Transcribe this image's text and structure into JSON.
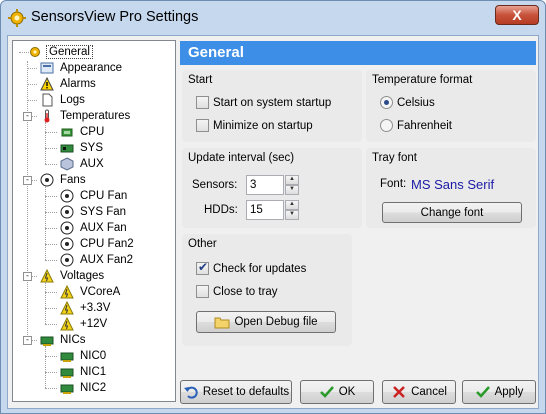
{
  "window": {
    "title": "SensorsView Pro Settings",
    "close_label": "X"
  },
  "tree": {
    "items": [
      {
        "label": "General",
        "icon": "gear-icon"
      },
      {
        "label": "Appearance",
        "icon": "appearance-icon"
      },
      {
        "label": "Alarms",
        "icon": "warning-icon"
      },
      {
        "label": "Logs",
        "icon": "document-icon"
      },
      {
        "label": "Temperatures",
        "icon": "thermometer-icon"
      },
      {
        "label": "CPU",
        "icon": "cpu-icon"
      },
      {
        "label": "SYS",
        "icon": "board-icon"
      },
      {
        "label": "AUX",
        "icon": "cube-icon"
      },
      {
        "label": "Fans",
        "icon": "fan-icon"
      },
      {
        "label": "CPU Fan",
        "icon": "fan-icon"
      },
      {
        "label": "SYS Fan",
        "icon": "fan-icon"
      },
      {
        "label": "AUX Fan",
        "icon": "fan-icon"
      },
      {
        "label": "CPU Fan2",
        "icon": "fan-icon"
      },
      {
        "label": "AUX Fan2",
        "icon": "fan-icon"
      },
      {
        "label": "Voltages",
        "icon": "voltage-icon"
      },
      {
        "label": "VCoreA",
        "icon": "voltage-icon"
      },
      {
        "label": "+3.3V",
        "icon": "voltage-icon"
      },
      {
        "label": "+12V",
        "icon": "voltage-icon"
      },
      {
        "label": "NICs",
        "icon": "nic-icon"
      },
      {
        "label": "NIC0",
        "icon": "nic-icon"
      },
      {
        "label": "NIC1",
        "icon": "nic-icon"
      },
      {
        "label": "NIC2",
        "icon": "nic-icon"
      }
    ]
  },
  "header": {
    "title": "General"
  },
  "start": {
    "title": "Start",
    "startup_label": "Start on system startup",
    "startup_checked": false,
    "minimize_label": "Minimize on startup",
    "minimize_checked": false
  },
  "temperature_format": {
    "title": "Temperature format",
    "celsius_label": "Celsius",
    "fahrenheit_label": "Fahrenheit",
    "selected": "Celsius"
  },
  "update_interval": {
    "title": "Update interval (sec)",
    "sensors_label": "Sensors:",
    "sensors_value": "3",
    "hdds_label": "HDDs:",
    "hdds_value": "15"
  },
  "tray_font": {
    "title": "Tray font",
    "font_label": "Font:",
    "font_value": "MS Sans Serif",
    "change_label": "Change font"
  },
  "other": {
    "title": "Other",
    "updates_label": "Check for updates",
    "updates_checked": true,
    "close_tray_label": "Close to tray",
    "close_tray_checked": false,
    "debug_label": "Open Debug file"
  },
  "footer": {
    "reset_label": "Reset to defaults",
    "ok_label": "OK",
    "cancel_label": "Cancel",
    "apply_label": "Apply"
  },
  "colors": {
    "header_bg": "#3d8ee6",
    "accent_green": "#2a9a2a",
    "cancel_red": "#cc2222"
  }
}
